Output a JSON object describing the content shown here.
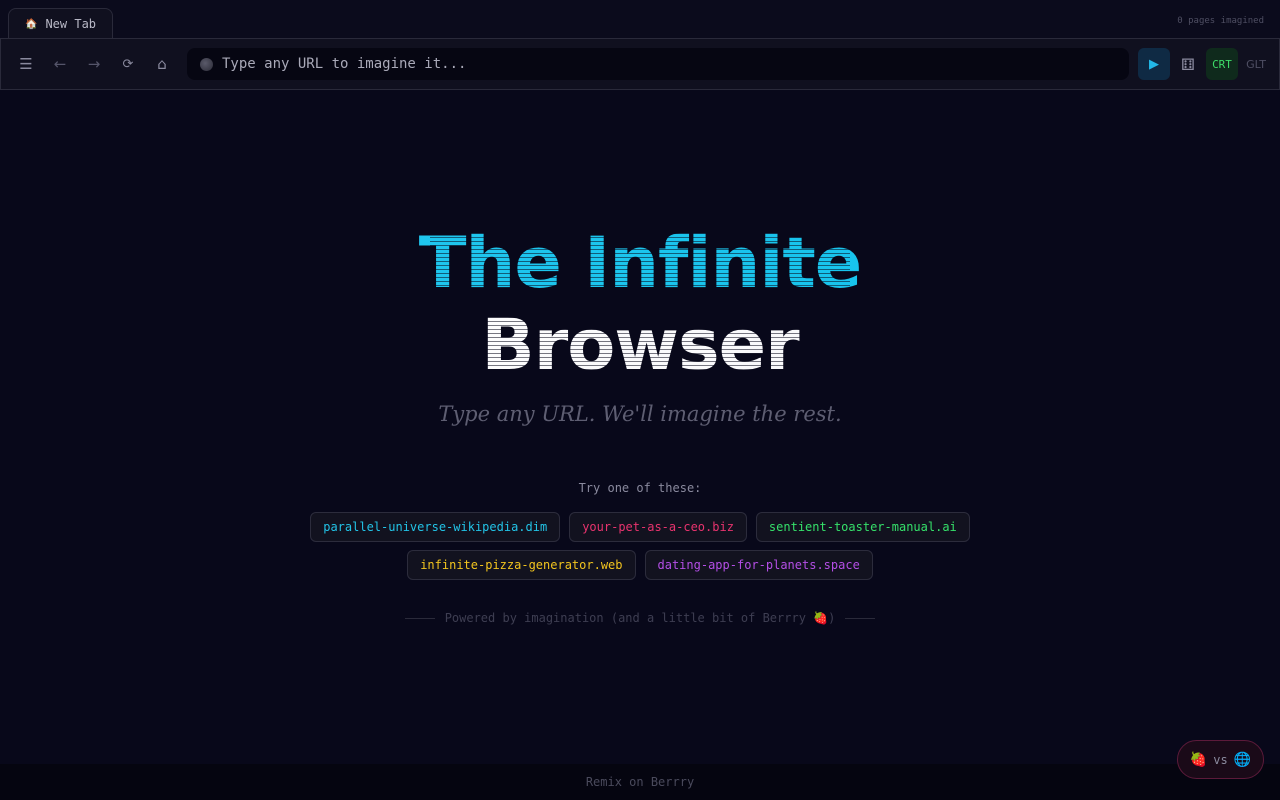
{
  "tabs": [
    {
      "icon": "home-icon",
      "label": "New Tab"
    }
  ],
  "pages_imagined": "0 pages imagined",
  "toolbar": {
    "menu_glyph": "☰",
    "back_glyph": "←",
    "forward_glyph": "→",
    "reload_glyph": "⟳",
    "home_glyph": "⌂",
    "url_placeholder": "Type any URL to imagine it...",
    "go_glyph": "▶",
    "dice_glyph": "⚅",
    "crt_label": "CRT",
    "glt_label": "GLT"
  },
  "hero": {
    "title_line1": "The Infinite",
    "title_line2": "Browser",
    "tagline": "Type any URL. We'll imagine the rest."
  },
  "suggestions": {
    "label": "Try one of these:",
    "rows": [
      [
        {
          "text": "parallel-universe-wikipedia.dim",
          "color": "#22c3e6"
        },
        {
          "text": "your-pet-as-a-ceo.biz",
          "color": "#e8336e"
        },
        {
          "text": "sentient-toaster-manual.ai",
          "color": "#35e06a"
        }
      ],
      [
        {
          "text": "infinite-pizza-generator.web",
          "color": "#f2c41e"
        },
        {
          "text": "dating-app-for-planets.space",
          "color": "#b44ee6"
        }
      ]
    ]
  },
  "powered_by": "Powered by imagination (and a little bit of Berrry 🍓)",
  "footer": {
    "remix": "Remix on Berrry"
  },
  "vs_badge": {
    "left": "🍓",
    "vs": "vs",
    "right": "🌐"
  }
}
